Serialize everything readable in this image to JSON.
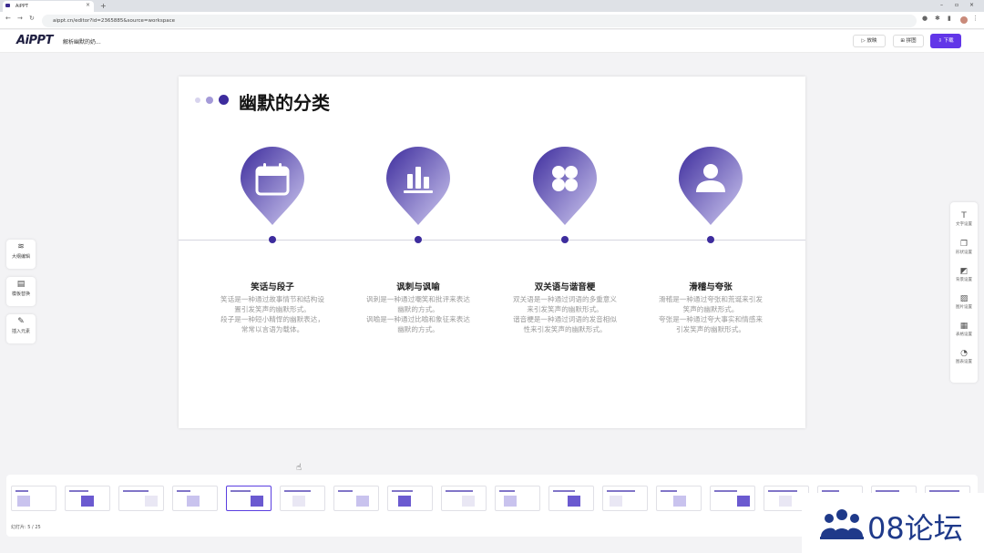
{
  "browser": {
    "tab_title": "AiPPT",
    "tab_close": "×",
    "new_tab": "+",
    "url": "aippt.cn/editor?id=2365885&source=workspace",
    "win_min": "–",
    "win_max": "▫",
    "win_close": "×"
  },
  "app": {
    "logo": "AiPPT",
    "doc_title": "解析幽默的奶...",
    "present_label": "放映",
    "share_label": "拼图",
    "download_label": "下载"
  },
  "slide": {
    "title": "幽默的分类",
    "colors": {
      "accent": "#3d2c9d",
      "accent_light": "#c6c0e8"
    },
    "cards": [
      {
        "icon": "calendar-icon",
        "title": "笑话与段子",
        "desc": [
          "笑话是一种通过故事情节和结构设",
          "置引发笑声的幽默形式。",
          "段子是一种短小精悍的幽默表达，",
          "常常以言语为载体。"
        ]
      },
      {
        "icon": "chart-icon",
        "title": "讽刺与讽喻",
        "desc": [
          "讽刺是一种通过嘲笑和批评来表达",
          "幽默的方式。",
          "讽喻是一种通过比喻和象征来表达",
          "幽默的方式。"
        ]
      },
      {
        "icon": "grid-icon",
        "title": "双关语与谐音梗",
        "desc": [
          "双关语是一种通过词语的多重意义",
          "来引发笑声的幽默形式。",
          "谐音梗是一种通过词语的发音相似",
          "性来引发笑声的幽默形式。"
        ]
      },
      {
        "icon": "user-icon",
        "title": "滑稽与夸张",
        "desc": [
          "滑稽是一种通过夸张和荒诞来引发",
          "笑声的幽默形式。",
          "夸张是一种通过夸大事实和情感来",
          "引发笑声的幽默形式。"
        ]
      }
    ]
  },
  "left_tools": [
    {
      "icon": "outline-icon",
      "label": "大纲编辑"
    },
    {
      "icon": "template-icon",
      "label": "模板替换"
    },
    {
      "icon": "insert-icon",
      "label": "插入元素"
    }
  ],
  "right_tools": [
    {
      "icon": "text-icon",
      "label": "文字设置"
    },
    {
      "icon": "shape-icon",
      "label": "形状设置"
    },
    {
      "icon": "background-icon",
      "label": "背景设置"
    },
    {
      "icon": "image-icon",
      "label": "图片设置"
    },
    {
      "icon": "table-icon",
      "label": "表格设置"
    },
    {
      "icon": "chart-settings-icon",
      "label": "图表设置"
    }
  ],
  "thumbnails": {
    "count": 18,
    "active_index": 4,
    "counter": "幻灯片: 5 / 25"
  },
  "watermark": "08论坛"
}
